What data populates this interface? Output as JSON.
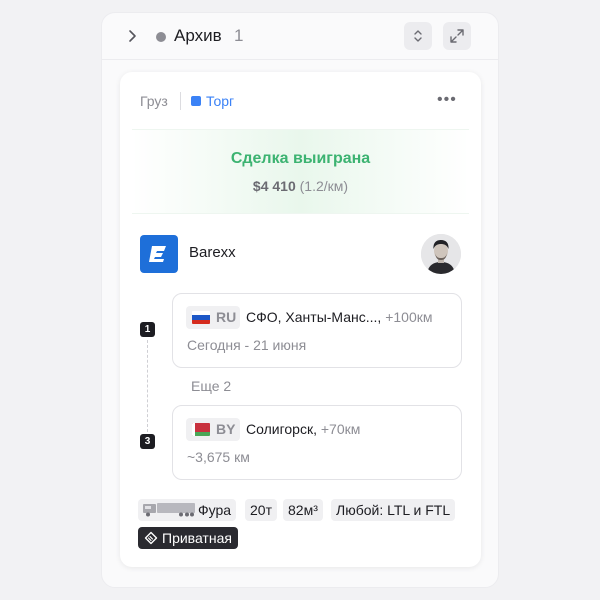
{
  "header": {
    "title": "Архив",
    "count": "1"
  },
  "card": {
    "type_label": "Груз",
    "source_label": "Торг",
    "status": {
      "title": "Сделка выиграна",
      "price": "$4 410",
      "rate": "(1.2/км)"
    },
    "company": {
      "name": "Barexx"
    },
    "route": {
      "stops": [
        {
          "number": "1",
          "country_code": "RU",
          "place": "СФО, Ханты-Манс...,",
          "extra_km": "+100км",
          "detail": "Сегодня - 21 июня"
        },
        {
          "number": "3",
          "country_code": "BY",
          "place": "Солигорск,",
          "extra_km": "+70км",
          "detail": "~3,675 км"
        }
      ],
      "more_label": "Еще 2"
    },
    "tags": {
      "truck": "Фура",
      "weight": "20т",
      "volume": "82м³",
      "load_type": "Любой: LTL и FTL"
    },
    "private_label": "Приватная"
  },
  "colors": {
    "accent_blue": "#3b82f6",
    "success_green": "#3cb371",
    "logo_blue": "#1e6fd9",
    "dark_badge": "#2a2a30"
  },
  "icons": [
    "chevron-right-icon",
    "sort-icon",
    "expand-icon",
    "more-icon",
    "company-logo-icon",
    "avatar",
    "flag-ru-icon",
    "flag-by-icon",
    "truck-icon",
    "handshake-icon"
  ]
}
